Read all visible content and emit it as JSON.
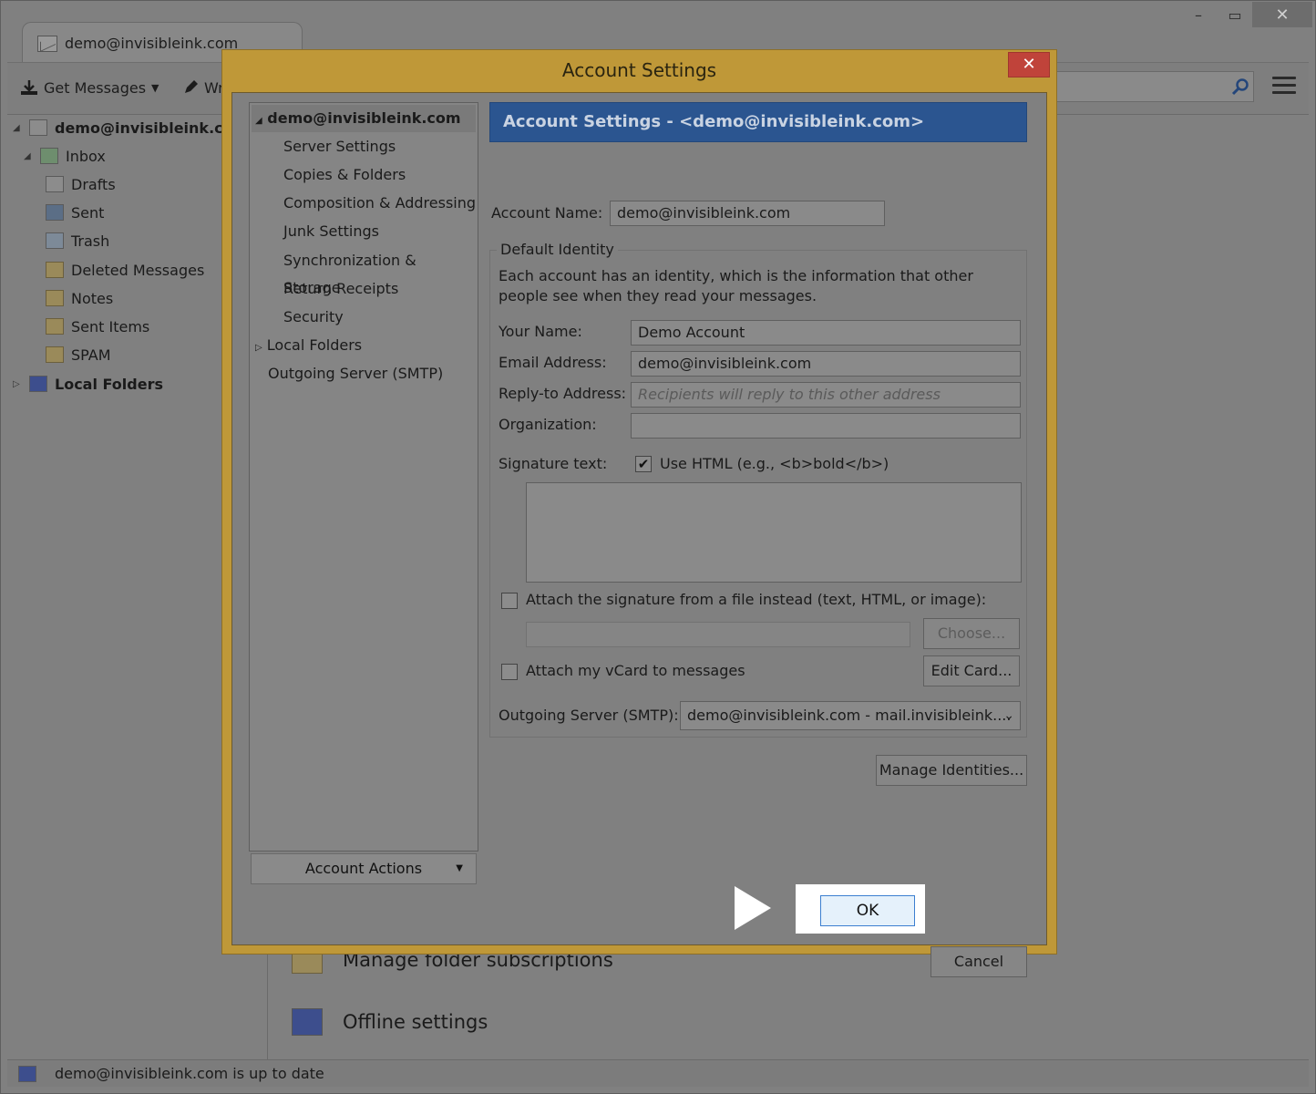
{
  "main_window": {
    "tab_title": "demo@invisibleink.com",
    "controls": {
      "minimize": "–",
      "maximize": "▭",
      "close": "✕"
    },
    "toolbar": {
      "get_messages": "Get Messages",
      "write": "Wr"
    },
    "folders": {
      "account": "demo@invisibleink.com",
      "items": [
        "Inbox",
        "Drafts",
        "Sent",
        "Trash",
        "Deleted Messages",
        "Notes",
        "Sent Items",
        "SPAM"
      ],
      "local": "Local Folders"
    },
    "content_links": {
      "manage_subscriptions": "Manage folder subscriptions",
      "offline": "Offline settings"
    },
    "status": "demo@invisibleink.com is up to date"
  },
  "dialog": {
    "title": "Account Settings",
    "close": "✕",
    "tree": {
      "account": "demo@invisibleink.com",
      "items": [
        "Server Settings",
        "Copies & Folders",
        "Composition & Addressing",
        "Junk Settings",
        "Synchronization & Storage",
        "Return Receipts",
        "Security"
      ],
      "local_folders": "Local Folders",
      "outgoing": "Outgoing Server (SMTP)"
    },
    "account_actions": "Account Actions",
    "header": "Account Settings - <demo@invisibleink.com>",
    "account_name_label": "Account Name:",
    "account_name_value": "demo@invisibleink.com",
    "identity": {
      "legend": "Default Identity",
      "description": "Each account has an identity, which is the information that other people see when they read your messages.",
      "your_name_label": "Your Name:",
      "your_name_value": "Demo Account",
      "email_label": "Email Address:",
      "email_value": "demo@invisibleink.com",
      "reply_to_label": "Reply-to Address:",
      "reply_to_placeholder": "Recipients will reply to this other address",
      "organization_label": "Organization:",
      "organization_value": "",
      "signature_label": "Signature text:",
      "use_html_label": "Use HTML (e.g., <b>bold</b>)",
      "use_html_checked": true,
      "attach_sig_label": "Attach the signature from a file instead (text, HTML, or image):",
      "attach_sig_checked": false,
      "choose_button": "Choose...",
      "vcard_label": "Attach my vCard to messages",
      "vcard_checked": false,
      "edit_card_button": "Edit Card...",
      "smtp_label": "Outgoing Server (SMTP):",
      "smtp_value": "demo@invisibleink.com - mail.invisibleink...."
    },
    "manage_identities": "Manage Identities...",
    "ok": "OK",
    "cancel": "Cancel"
  }
}
